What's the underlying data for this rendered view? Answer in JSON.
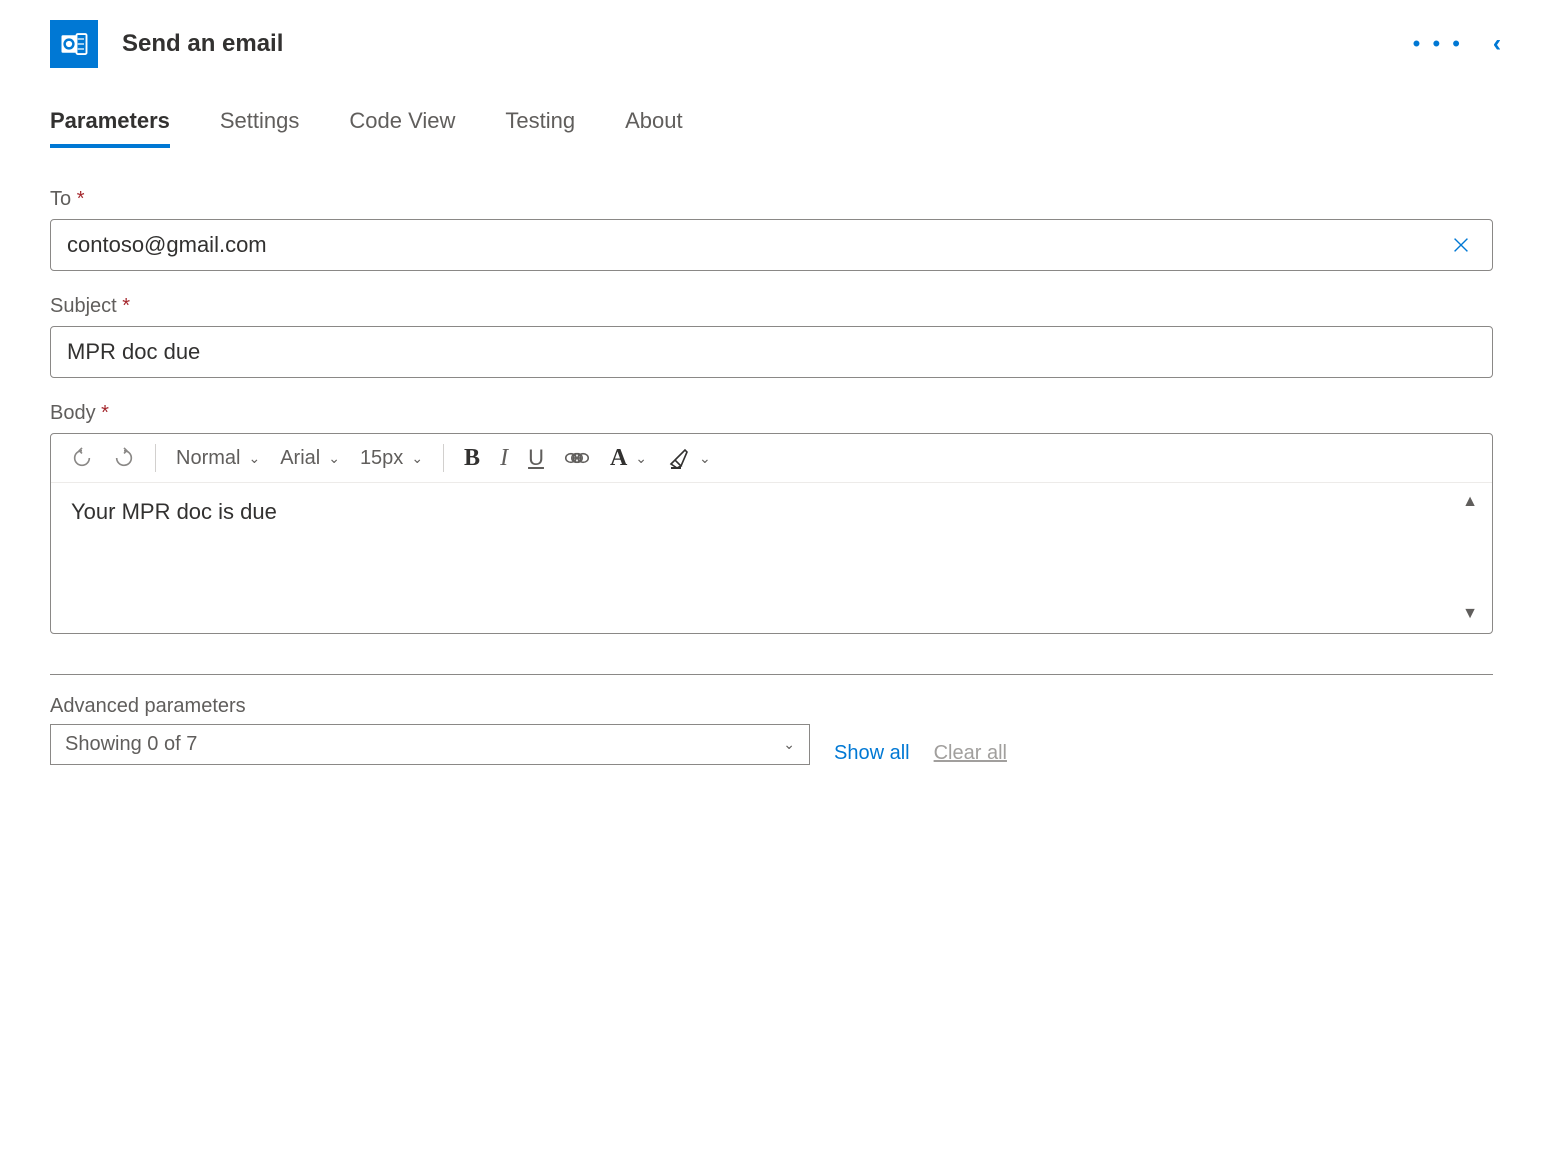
{
  "header": {
    "title": "Send an email"
  },
  "tabs": [
    {
      "label": "Parameters",
      "active": true
    },
    {
      "label": "Settings",
      "active": false
    },
    {
      "label": "Code View",
      "active": false
    },
    {
      "label": "Testing",
      "active": false
    },
    {
      "label": "About",
      "active": false
    }
  ],
  "fields": {
    "to": {
      "label": "To",
      "value": "contoso@gmail.com"
    },
    "subject": {
      "label": "Subject",
      "value": "MPR doc due"
    },
    "body": {
      "label": "Body",
      "content": "Your MPR doc is due"
    }
  },
  "editor_toolbar": {
    "style": "Normal",
    "font": "Arial",
    "size": "15px"
  },
  "advanced": {
    "label": "Advanced parameters",
    "showing": "Showing 0 of 7",
    "show_all": "Show all",
    "clear_all": "Clear all"
  },
  "required_mark": "*"
}
